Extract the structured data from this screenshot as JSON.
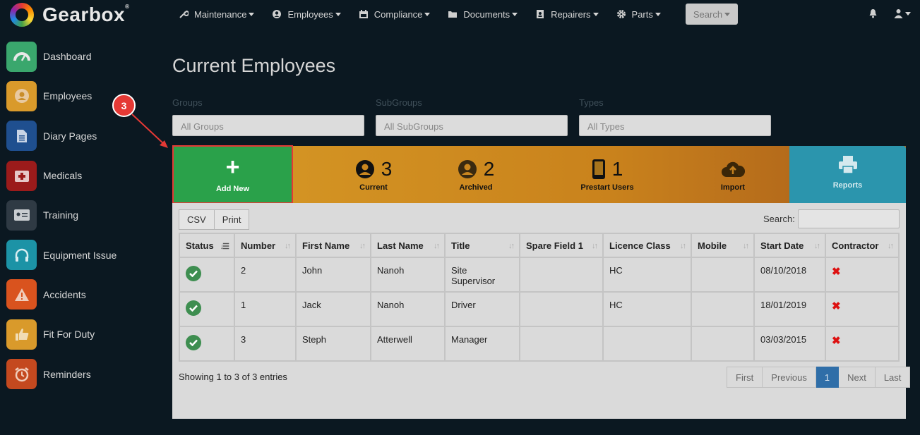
{
  "brand": {
    "name": "Gearbox"
  },
  "nav": {
    "items": [
      {
        "label": "Maintenance",
        "icon": "wrench-icon"
      },
      {
        "label": "Employees",
        "icon": "user-circle-icon"
      },
      {
        "label": "Compliance",
        "icon": "calendar-icon"
      },
      {
        "label": "Documents",
        "icon": "folder-icon"
      },
      {
        "label": "Repairers",
        "icon": "address-book-icon"
      },
      {
        "label": "Parts",
        "icon": "gear-icon"
      }
    ],
    "search_label": "Search"
  },
  "sidebar": {
    "items": [
      {
        "label": "Dashboard",
        "icon": "dashboard-gauge-icon",
        "color": "#3aa76d"
      },
      {
        "label": "Employees",
        "icon": "employee-icon",
        "color": "#d99a2b"
      },
      {
        "label": "Diary Pages",
        "icon": "document-icon",
        "color": "#1f4f8f"
      },
      {
        "label": "Medicals",
        "icon": "medical-kit-icon",
        "color": "#9b1b1b"
      },
      {
        "label": "Training",
        "icon": "id-card-icon",
        "color": "#2f3a44"
      },
      {
        "label": "Equipment Issue",
        "icon": "headphones-icon",
        "color": "#1c93a6"
      },
      {
        "label": "Accidents",
        "icon": "warning-icon",
        "color": "#d9531e"
      },
      {
        "label": "Fit For Duty",
        "icon": "thumbs-up-icon",
        "color": "#d99a2b"
      },
      {
        "label": "Reminders",
        "icon": "alarm-clock-icon",
        "color": "#c4491f"
      }
    ]
  },
  "page": {
    "title": "Current Employees"
  },
  "filters": {
    "groups": {
      "label": "Groups",
      "value": "All Groups"
    },
    "subgroups": {
      "label": "SubGroups",
      "value": "All SubGroups"
    },
    "types": {
      "label": "Types",
      "value": "All Types"
    }
  },
  "stats": {
    "add_new": {
      "label": "Add New"
    },
    "current": {
      "count": "3",
      "label": "Current"
    },
    "archived": {
      "count": "2",
      "label": "Archived"
    },
    "prestart": {
      "count": "1",
      "label": "Prestart Users"
    },
    "import": {
      "label": "Import"
    },
    "reports": {
      "label": "Reports"
    }
  },
  "table": {
    "buttons": {
      "csv": "CSV",
      "print": "Print"
    },
    "search_label": "Search:",
    "columns": [
      "Status",
      "Number",
      "First Name",
      "Last Name",
      "Title",
      "Spare Field 1",
      "Licence Class",
      "Mobile",
      "Start Date",
      "Contractor"
    ],
    "rows": [
      {
        "number": "2",
        "first": "John",
        "last": "Nanoh",
        "title": "Site Supervisor",
        "spare": "",
        "licence": "HC",
        "mobile": "",
        "start": "08/10/2018"
      },
      {
        "number": "1",
        "first": "Jack",
        "last": "Nanoh",
        "title": "Driver",
        "spare": "",
        "licence": "HC",
        "mobile": "",
        "start": "18/01/2019"
      },
      {
        "number": "3",
        "first": "Steph",
        "last": "Atterwell",
        "title": "Manager",
        "spare": "",
        "licence": "",
        "mobile": "",
        "start": "03/03/2015"
      }
    ],
    "entries_text": "Showing 1 to 3 of 3 entries"
  },
  "pagination": {
    "first": "First",
    "previous": "Previous",
    "current": "1",
    "next": "Next",
    "last": "Last"
  },
  "annotation": {
    "step": "3"
  }
}
